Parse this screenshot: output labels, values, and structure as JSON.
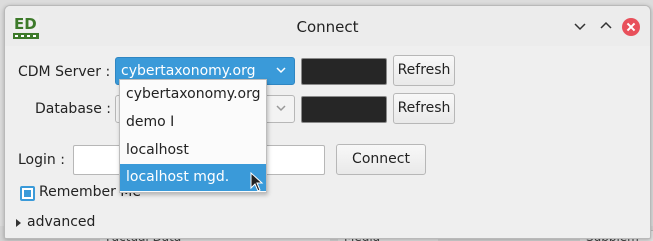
{
  "window": {
    "title": "Connect"
  },
  "title_bar_icons": [
    "app-logo-icon",
    "minimize-chevron-down-icon",
    "maximize-chevron-up-icon",
    "close-icon"
  ],
  "form": {
    "cdm_server_label": "CDM Server :",
    "cdm_server_value": "cybertaxonomy.org",
    "database_label": "Database :",
    "refresh_label": "Refresh",
    "login_label": "Login :",
    "login_value": "",
    "connect_label": "Connect",
    "remember_me_label": "Remember Me",
    "remember_me_checked": true,
    "advanced_label": "advanced"
  },
  "dropdown": {
    "items": [
      {
        "label": "cybertaxonomy.org"
      },
      {
        "label": "demo I"
      },
      {
        "label": "localhost"
      },
      {
        "label": "localhost mgd."
      }
    ],
    "highlighted_index": 3
  },
  "background_tabs": [
    "Factual Data",
    "Media",
    "Supplem"
  ],
  "colors": {
    "accent": "#3a9ad9",
    "close": "#e8505b"
  }
}
